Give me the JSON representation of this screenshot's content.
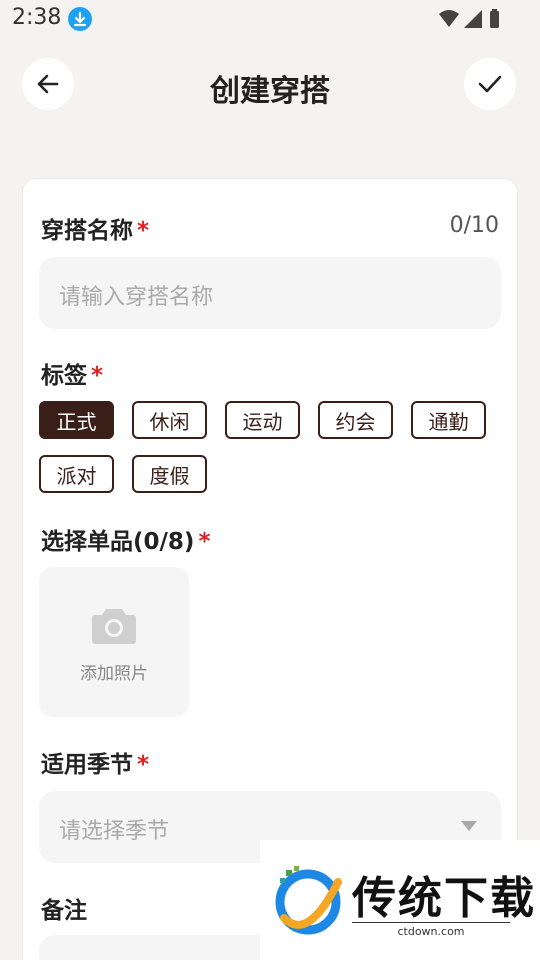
{
  "status_bar": {
    "time": "2:38"
  },
  "header": {
    "title": "创建穿搭"
  },
  "form": {
    "name": {
      "label": "穿搭名称",
      "required_mark": "*",
      "counter": "0/10",
      "placeholder": "请输入穿搭名称"
    },
    "tags": {
      "label": "标签",
      "required_mark": "*",
      "items": [
        {
          "label": "正式",
          "selected": true
        },
        {
          "label": "休闲",
          "selected": false
        },
        {
          "label": "运动",
          "selected": false
        },
        {
          "label": "约会",
          "selected": false
        },
        {
          "label": "通勤",
          "selected": false
        },
        {
          "label": "派对",
          "selected": false
        },
        {
          "label": "度假",
          "selected": false
        }
      ]
    },
    "items": {
      "label": "选择单品(0/8)",
      "required_mark": "*",
      "add_photo": "添加照片"
    },
    "season": {
      "label": "适用季节",
      "required_mark": "*",
      "placeholder": "请选择季节"
    },
    "notes": {
      "label": "备注"
    }
  },
  "watermark": {
    "title": "传统下载",
    "url": "ctdown.com"
  },
  "colors": {
    "accent": "#3a1f18",
    "required": "#e02020",
    "background": "#f5f3f1"
  }
}
